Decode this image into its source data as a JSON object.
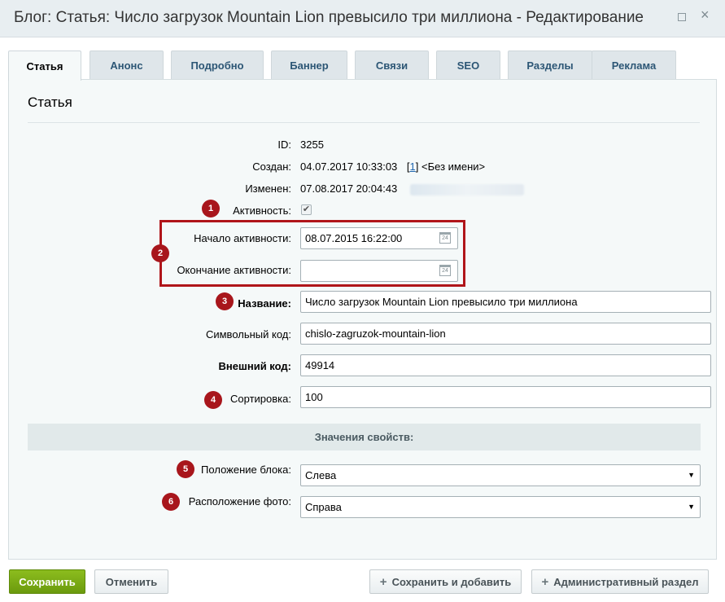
{
  "window": {
    "title": "Блог: Статья: Число загрузок Mountain Lion превысило три миллиона - Редактирование",
    "maximize_glyph": "□",
    "close_glyph": "×"
  },
  "tabs": [
    {
      "label": "Статья",
      "active": true
    },
    {
      "label": "Анонс"
    },
    {
      "label": "Подробно"
    },
    {
      "label": "Баннер"
    },
    {
      "label": "Связи"
    },
    {
      "label": "SEO"
    },
    {
      "label": "Разделы"
    },
    {
      "label": "Реклама"
    }
  ],
  "section": {
    "title": "Статья"
  },
  "fields": {
    "id": {
      "label": "ID:",
      "value": "3255"
    },
    "created": {
      "label": "Создан:",
      "value": "04.07.2017 10:33:03",
      "user_link": "1",
      "user_name": "<Без имени>"
    },
    "modified": {
      "label": "Изменен:",
      "value": "07.08.2017 20:04:43"
    },
    "active": {
      "label": "Активность:",
      "checked": true,
      "check_glyph": "✔"
    },
    "active_from": {
      "label": "Начало активности:",
      "value": "08.07.2015 16:22:00"
    },
    "active_to": {
      "label": "Окончание активности:",
      "value": ""
    },
    "name": {
      "label": "Название:",
      "value": "Число загрузок Mountain Lion превысило три миллиона"
    },
    "code": {
      "label": "Символьный код:",
      "value": "chislo-zagruzok-mountain-lion"
    },
    "external_code": {
      "label": "Внешний код:",
      "value": "49914"
    },
    "sort": {
      "label": "Сортировка:",
      "value": "100"
    }
  },
  "properties": {
    "header": "Значения свойств:",
    "block_position": {
      "label": "Положение блока:",
      "value": "Слева"
    },
    "photo_position": {
      "label": "Расположение фото:",
      "value": "Справа"
    }
  },
  "calendar_icon_text": "24",
  "select_arrow_glyph": "▼",
  "badges": [
    "1",
    "2",
    "3",
    "4",
    "5",
    "6"
  ],
  "buttons": {
    "save": "Сохранить",
    "cancel": "Отменить",
    "save_add": "Сохранить и добавить",
    "admin_section": "Административный раздел",
    "plus_glyph": "+"
  },
  "colors": {
    "accent_green": "#7aab14",
    "annotation_red": "#a8161c",
    "link_blue": "#2067b0"
  }
}
